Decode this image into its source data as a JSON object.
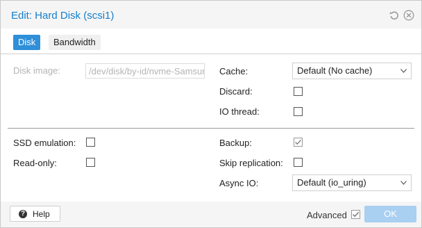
{
  "window": {
    "title": "Edit: Hard Disk (scsi1)"
  },
  "tabs": [
    {
      "label": "Disk",
      "active": true
    },
    {
      "label": "Bandwidth",
      "active": false
    }
  ],
  "fields": {
    "disk_image": {
      "label": "Disk image:",
      "value": "/dev/disk/by-id/nvme-Samsung",
      "disabled": true
    },
    "cache": {
      "label": "Cache:",
      "value": "Default (No cache)"
    },
    "discard": {
      "label": "Discard:",
      "checked": false
    },
    "io_thread": {
      "label": "IO thread:",
      "checked": false
    },
    "ssd_emulation": {
      "label": "SSD emulation:",
      "checked": false
    },
    "read_only": {
      "label": "Read-only:",
      "checked": false
    },
    "backup": {
      "label": "Backup:",
      "checked": true,
      "disabled": true
    },
    "skip_replication": {
      "label": "Skip replication:",
      "checked": false
    },
    "async_io": {
      "label": "Async IO:",
      "value": "Default (io_uring)"
    }
  },
  "footer": {
    "help_label": "Help",
    "help_icon_glyph": "?",
    "advanced_label": "Advanced",
    "advanced_checked": true,
    "ok_label": "OK"
  },
  "colors": {
    "accent": "#157fcc",
    "tab_active_bg": "#2f8fd8",
    "ok_button_disabled_bg": "#a9cff1"
  },
  "icons": {
    "reset": "reset-icon",
    "close": "close-icon",
    "dropdown": "chevron-down-icon",
    "help": "question-circle-icon",
    "check": "check-icon"
  }
}
